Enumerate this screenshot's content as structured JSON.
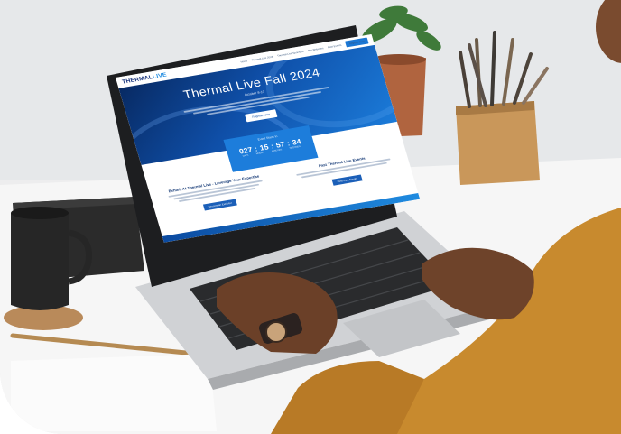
{
  "scene": {
    "description_colors": {
      "primary_blue": "#1d7ddb",
      "navy": "#14307a",
      "jacket": "#c88a2e",
      "desk": "#f4f4f4"
    }
  },
  "website": {
    "logo": {
      "word1": "THERMAL",
      "word2": "LIVE"
    },
    "nav_links": [
      "Home",
      "Thermal Live 2024",
      "Thermal Live Sponsors",
      "Our Webinars",
      "Past Events"
    ],
    "nav_button": "Register Now",
    "hero": {
      "title": "Thermal Live Fall 2024",
      "dates": "October 8-10",
      "cta": "Register Now"
    },
    "countdown": {
      "label": "Event Starts In",
      "days": "027",
      "hours": "15",
      "minutes": "57",
      "seconds": "34",
      "units": [
        "DAYS",
        "HOURS",
        "MINUTES",
        "SECONDS"
      ]
    },
    "left_section": {
      "heading": "Exhibit At Thermal Live - Leverage Your Expertise",
      "button": "Become an Exhibitor"
    },
    "right_section": {
      "heading": "Past Thermal Live Events",
      "button": "View Past Events"
    }
  }
}
